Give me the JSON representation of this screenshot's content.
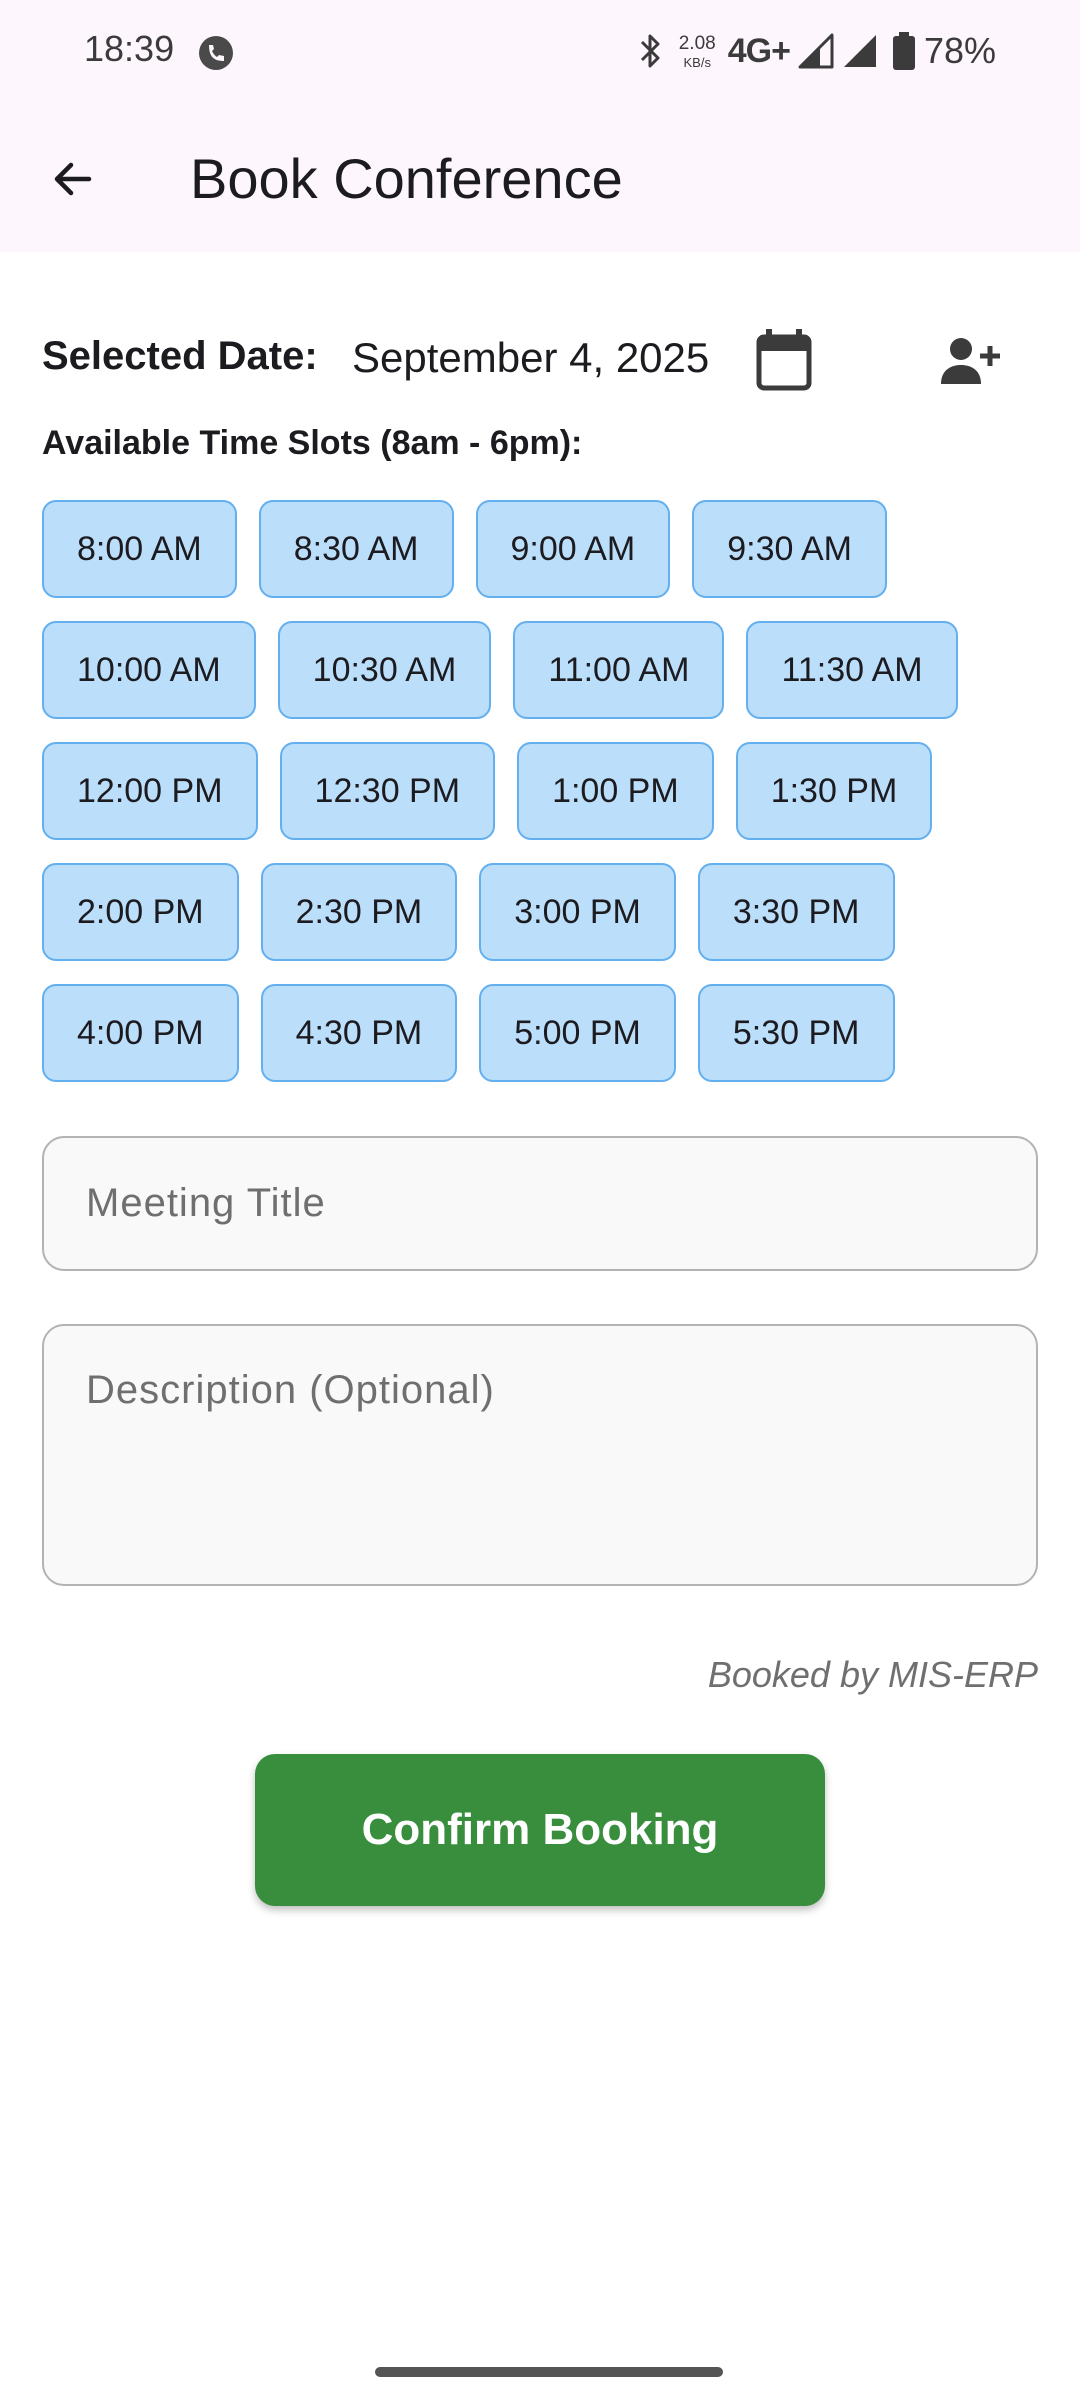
{
  "status_bar": {
    "time": "18:39",
    "net_speed_value": "2.08",
    "net_speed_unit": "KB/s",
    "network_type": "4G+",
    "battery_percent": "78%",
    "icons": [
      "app-notification-icon",
      "bluetooth-icon",
      "signal-icon",
      "battery-icon"
    ]
  },
  "app_bar": {
    "title": "Book Conference",
    "back_icon": "arrow-back-icon"
  },
  "date_row": {
    "label": "Selected Date:",
    "value": "September 4, 2025",
    "calendar_icon": "calendar-icon",
    "add_person_icon": "person-add-icon"
  },
  "slots": {
    "heading": "Available Time Slots (8am - 6pm):",
    "rows": [
      [
        "8:00 AM",
        "8:30 AM",
        "9:00 AM",
        "9:30 AM"
      ],
      [
        "10:00 AM",
        "10:30 AM",
        "11:00 AM",
        "11:30 AM"
      ],
      [
        "12:00 PM",
        "12:30 PM",
        "1:00 PM",
        "1:30 PM"
      ],
      [
        "2:00 PM",
        "2:30 PM",
        "3:00 PM",
        "3:30 PM"
      ],
      [
        "4:00 PM",
        "4:30 PM",
        "5:00 PM",
        "5:30 PM"
      ]
    ]
  },
  "form": {
    "title_placeholder": "Meeting Title",
    "title_value": "",
    "description_placeholder": "Description (Optional)",
    "description_value": ""
  },
  "booked_by": "Booked by MIS-ERP",
  "confirm_label": "Confirm Booking",
  "colors": {
    "app_bar_bg": "#fdf6fc",
    "slot_bg": "#bbdefb",
    "slot_border": "#64b0ee",
    "confirm_bg": "#388e3c"
  }
}
